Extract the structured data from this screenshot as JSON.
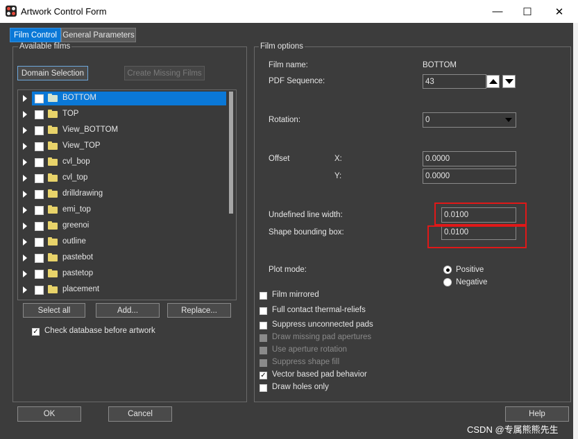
{
  "window": {
    "title": "Artwork Control Form",
    "minimize": "—",
    "maximize": "☐",
    "close": "✕"
  },
  "tabs": [
    {
      "label": "Film Control",
      "active": true
    },
    {
      "label": "General Parameters",
      "active": false
    }
  ],
  "left": {
    "group_title": "Available films",
    "domain_selection": "Domain Selection",
    "create_missing": "Create Missing Films",
    "films": [
      "BOTTOM",
      "TOP",
      "View_BOTTOM",
      "View_TOP",
      "cvl_bop",
      "cvl_top",
      "drilldrawing",
      "emi_top",
      "greenoi",
      "outline",
      "pastebot",
      "pastetop",
      "placement"
    ],
    "selected_index": 0,
    "select_all": "Select all",
    "add": "Add...",
    "replace": "Replace...",
    "check_db_label": "Check database before artwork",
    "check_db_checked": true
  },
  "right": {
    "group_title": "Film options",
    "film_name_label": "Film name:",
    "film_name_value": "BOTTOM",
    "pdf_sequence_label": "PDF Sequence:",
    "pdf_sequence_value": "43",
    "rotation_label": "Rotation:",
    "rotation_value": "0",
    "offset_label": "Offset",
    "offset_x_label": "X:",
    "offset_x_value": "0.0000",
    "offset_y_label": "Y:",
    "offset_y_value": "0.0000",
    "undefined_lw_label": "Undefined line width:",
    "undefined_lw_value": "0.0100",
    "shape_bb_label": "Shape bounding box:",
    "shape_bb_value": "0.0100",
    "plot_mode_label": "Plot mode:",
    "plot_positive": "Positive",
    "plot_negative": "Negative",
    "plot_mode_selected": "Positive",
    "options": [
      {
        "label": "Film mirrored",
        "checked": false,
        "enabled": true
      },
      {
        "label": "Full contact thermal-reliefs",
        "checked": false,
        "enabled": true
      },
      {
        "label": "Suppress unconnected pads",
        "checked": false,
        "enabled": true
      },
      {
        "label": "Draw missing pad apertures",
        "checked": false,
        "enabled": false
      },
      {
        "label": "Use aperture rotation",
        "checked": false,
        "enabled": false
      },
      {
        "label": "Suppress shape fill",
        "checked": false,
        "enabled": false
      },
      {
        "label": "Vector based pad behavior",
        "checked": true,
        "enabled": true
      },
      {
        "label": "Draw holes only",
        "checked": false,
        "enabled": true
      }
    ]
  },
  "footer": {
    "ok": "OK",
    "cancel": "Cancel",
    "help": "Help"
  },
  "watermark": "CSDN @专属熊熊先生",
  "colors": {
    "selection": "#0a78d7",
    "active_tab": "#0a78d7",
    "highlight_box": "#e01818"
  },
  "icons": {
    "expand": "chevron-right-icon",
    "folder": "folder-icon",
    "spin_up": "triangle-up-icon",
    "spin_down": "triangle-down-icon",
    "dropdown": "triangle-down-icon"
  }
}
